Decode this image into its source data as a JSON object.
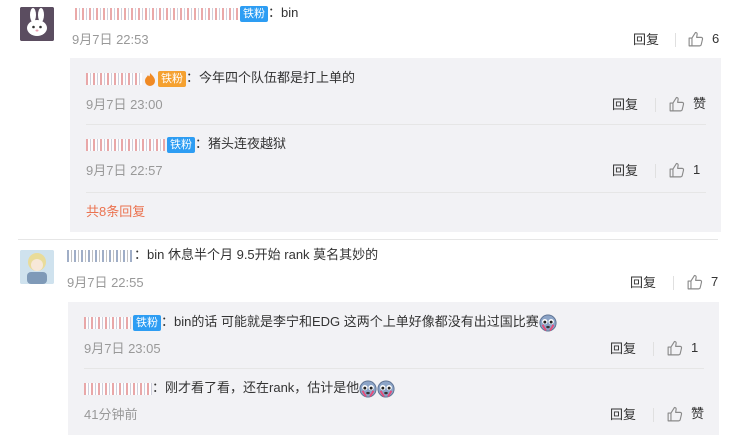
{
  "comments": [
    {
      "badge": "铁粉",
      "sep": "：",
      "text": "bin",
      "time": "9月7日 22:53",
      "reply_label": "回复",
      "like_count": "6",
      "replies": [
        {
          "badge": "铁粉",
          "sep": "：",
          "text": "今年四个队伍都是打上单的",
          "time": "9月7日 23:00",
          "reply_label": "回复",
          "like_label": "赞"
        },
        {
          "badge": "铁粉",
          "sep": "：",
          "text": "猪头连夜越狱",
          "time": "9月7日 22:57",
          "reply_label": "回复",
          "like_label": "1"
        }
      ],
      "more_replies": "共8条回复"
    },
    {
      "sep": "：",
      "text": "bin 休息半个月 9.5开始 rank 莫名其妙的",
      "time": "9月7日 22:55",
      "reply_label": "回复",
      "like_count": "7",
      "replies": [
        {
          "badge": "铁粉",
          "sep": "：",
          "text": "bin的话 可能就是李宁和EDG 这两个上单好像都没有出过国比赛",
          "time": "9月7日 23:05",
          "reply_label": "回复",
          "like_label": "1"
        },
        {
          "sep": "：",
          "text": "刚才看了看，还在rank，估计是他",
          "time": "41分钟前",
          "reply_label": "回复",
          "like_label": "赞"
        }
      ]
    }
  ],
  "icons": {
    "like": "thumbs-up-icon",
    "emoji": "crying-face-emoji-icon"
  },
  "colors": {
    "badge_blue": "#2d9df3",
    "badge_orange": "#f5a130",
    "more_link": "#eb7350",
    "panel_bg": "#f2f2f5"
  }
}
